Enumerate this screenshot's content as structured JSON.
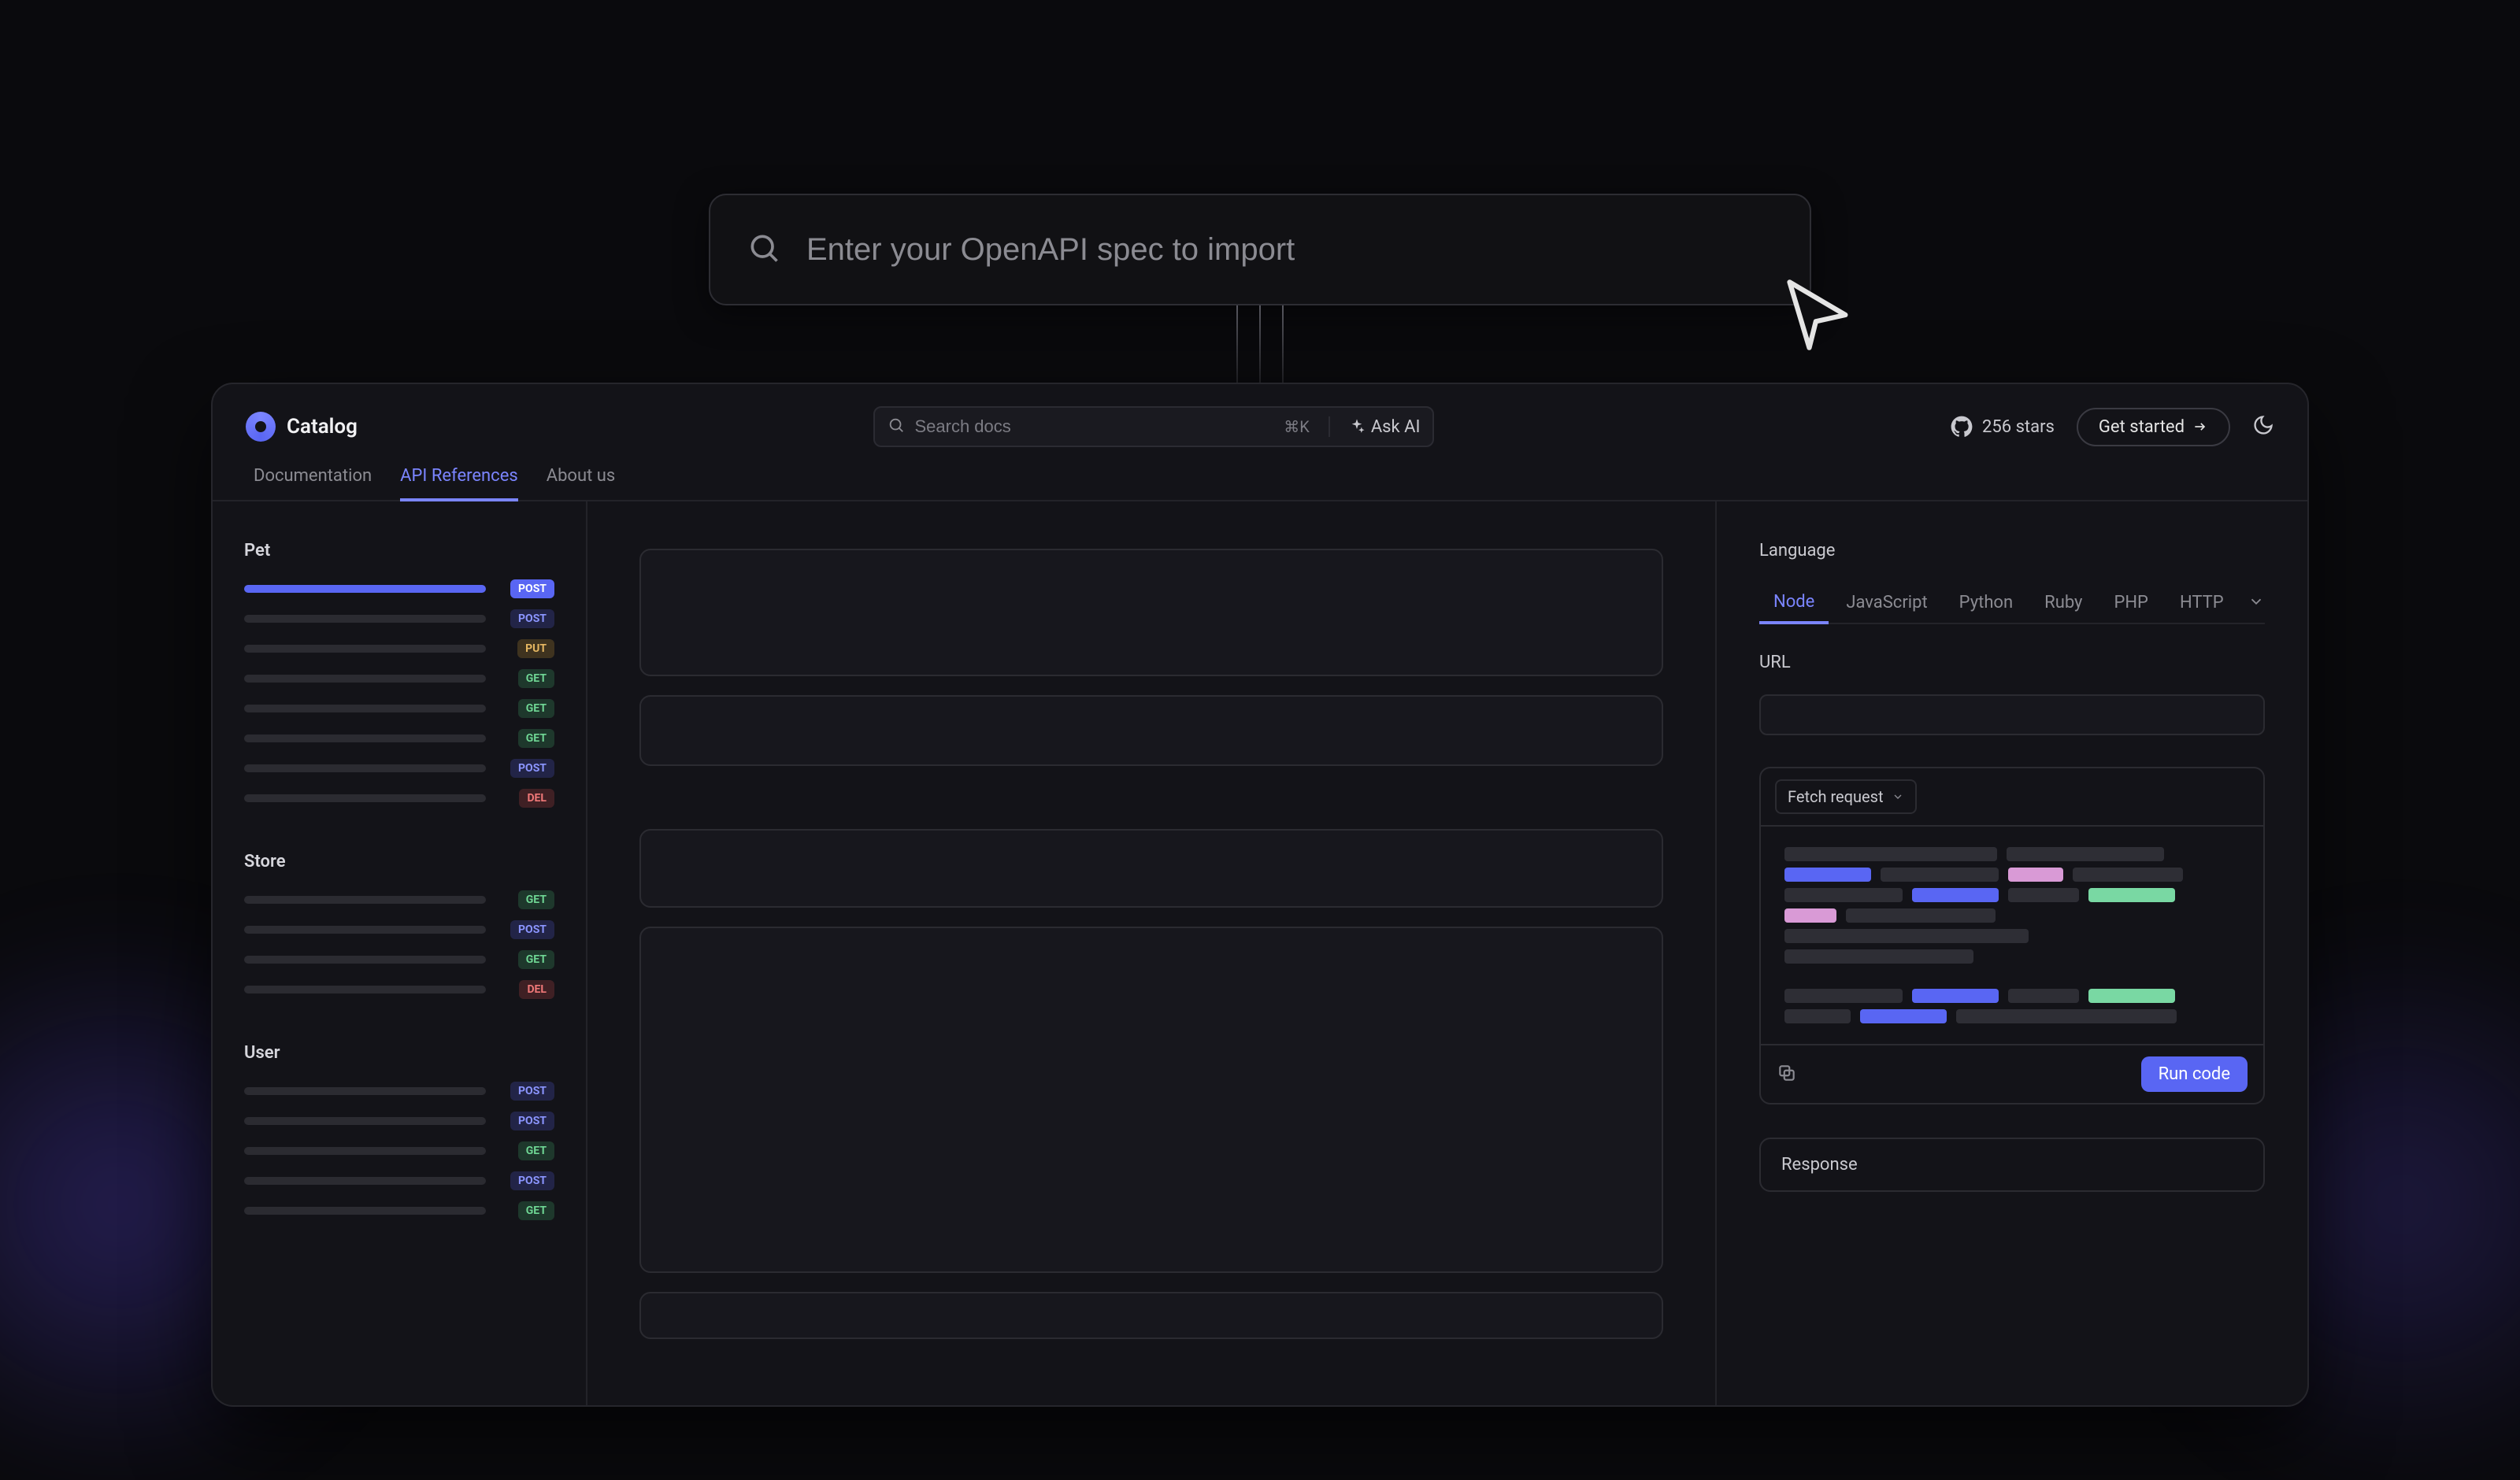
{
  "hero": {
    "placeholder": "Enter your OpenAPI spec to import"
  },
  "header": {
    "brand": "Catalog",
    "search_placeholder": "Search docs",
    "kbd": "⌘K",
    "ask_ai": "Ask AI",
    "stars": "256 stars",
    "get_started": "Get started"
  },
  "top_tabs": [
    {
      "label": "Documentation",
      "active": false
    },
    {
      "label": "API References",
      "active": true
    },
    {
      "label": "About us",
      "active": false
    }
  ],
  "sidebar": [
    {
      "title": "Pet",
      "items": [
        {
          "method": "POST",
          "class": "m-post",
          "width": 78,
          "active": true
        },
        {
          "method": "POST",
          "class": "m-post",
          "width": 78
        },
        {
          "method": "PUT",
          "class": "m-put",
          "width": 78
        },
        {
          "method": "GET",
          "class": "m-get",
          "width": 78
        },
        {
          "method": "GET",
          "class": "m-get",
          "width": 78
        },
        {
          "method": "GET",
          "class": "m-get",
          "width": 78
        },
        {
          "method": "POST",
          "class": "m-post",
          "width": 78
        },
        {
          "method": "DEL",
          "class": "m-del",
          "width": 78
        }
      ]
    },
    {
      "title": "Store",
      "items": [
        {
          "method": "GET",
          "class": "m-get",
          "width": 78
        },
        {
          "method": "POST",
          "class": "m-post",
          "width": 78
        },
        {
          "method": "GET",
          "class": "m-get",
          "width": 78
        },
        {
          "method": "DEL",
          "class": "m-del",
          "width": 78
        }
      ]
    },
    {
      "title": "User",
      "items": [
        {
          "method": "POST",
          "class": "m-post",
          "width": 78
        },
        {
          "method": "POST",
          "class": "m-post",
          "width": 78
        },
        {
          "method": "GET",
          "class": "m-get",
          "width": 78
        },
        {
          "method": "POST",
          "class": "m-post",
          "width": 78
        },
        {
          "method": "GET",
          "class": "m-get",
          "width": 78
        }
      ]
    }
  ],
  "rpanel": {
    "language_label": "Language",
    "url_label": "URL",
    "lang_tabs": [
      "Node",
      "JavaScript",
      "Python",
      "Ruby",
      "PHP",
      "HTTP"
    ],
    "fetch_label": "Fetch request",
    "run_label": "Run code",
    "response_label": "Response"
  }
}
